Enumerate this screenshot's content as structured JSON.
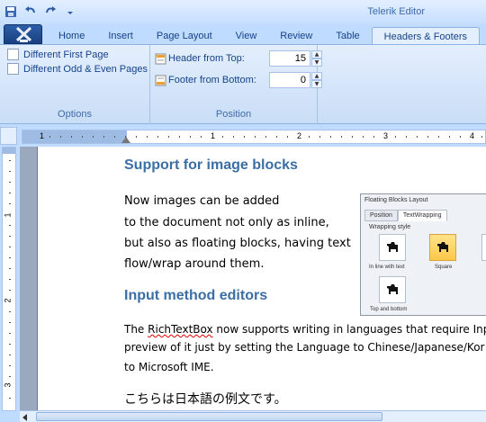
{
  "window": {
    "title": "Telerik Editor"
  },
  "quick_access": {
    "icons": [
      "save-icon",
      "undo-icon",
      "redo-icon",
      "customize-dropdown-icon"
    ]
  },
  "tabs": [
    {
      "label": "Home",
      "active": false
    },
    {
      "label": "Insert",
      "active": false
    },
    {
      "label": "Page Layout",
      "active": false
    },
    {
      "label": "View",
      "active": false
    },
    {
      "label": "Review",
      "active": false
    },
    {
      "label": "Table",
      "active": false
    },
    {
      "label": "Headers & Footers",
      "active": true
    }
  ],
  "ribbon": {
    "options": {
      "label": "Options",
      "different_first_page": {
        "label": "Different First Page",
        "checked": false
      },
      "different_odd_even": {
        "label": "Different Odd & Even Pages",
        "checked": false
      }
    },
    "position": {
      "label": "Position",
      "header_from_top": {
        "label": "Header from Top:",
        "value": "15"
      },
      "footer_from_bottom": {
        "label": "Footer from Bottom:",
        "value": "0"
      }
    }
  },
  "ruler": {
    "h_numbers": [
      "1",
      "1",
      "2",
      "3",
      "4"
    ],
    "v_numbers": [
      "1",
      "2",
      "3"
    ]
  },
  "document": {
    "heading1": "Support for image blocks",
    "para1": [
      "Now images can be added",
      "to the document not only as inline,",
      "but also as floating blocks, having text",
      "flow/wrap around them."
    ],
    "heading2": "Input method editors",
    "para2_line1_pre": "The ",
    "para2_line1_word": "RichTextBox",
    "para2_line1_post": " now supports writing in languages that require Inp",
    "para2_line2": "preview of it just by setting the Language to Chinese/Japanese/Kor",
    "para2_line3": "to Microsoft IME.",
    "japanese": "こちらは日本語の例文です。"
  },
  "embedded_image": {
    "title": "Floating Blocks Layout",
    "tabs": [
      "Position",
      "TextWrapping"
    ],
    "section": "Wrapping style",
    "options": [
      "In line with text",
      "Square",
      "B",
      "Top and bottom"
    ]
  },
  "colors": {
    "heading": "#3a6ea5",
    "ribbon_text": "#15428b",
    "app_button": "#1a3f80"
  }
}
